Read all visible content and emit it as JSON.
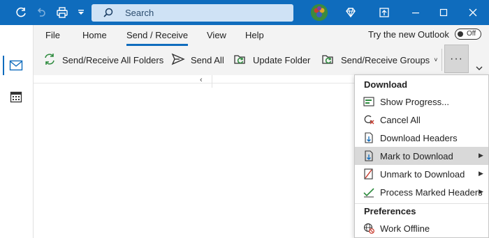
{
  "title_bar": {
    "search_placeholder": "Search",
    "icons": [
      "refresh-icon",
      "undo-icon",
      "print-icon",
      "customize-toolbar-icon",
      "search-icon",
      "avatar",
      "premium-diamond-icon",
      "popout-icon",
      "minimize-icon",
      "restore-icon",
      "close-icon"
    ]
  },
  "left_rail": {
    "items": [
      "mail-icon",
      "calendar-icon"
    ]
  },
  "ribbon": {
    "tabs": [
      "File",
      "Home",
      "Send / Receive",
      "View",
      "Help"
    ],
    "active_tab": "Send / Receive",
    "try_new": "Try the new Outlook",
    "toggle_label": "Off",
    "commands": [
      "Send/Receive All Folders",
      "Send All",
      "Update Folder",
      "Send/Receive Groups"
    ],
    "more_label": "···"
  },
  "menu": {
    "download_header": "Download",
    "download_items": [
      {
        "label": "Show Progress...",
        "icon": "progress-icon",
        "submenu": false
      },
      {
        "label": "Cancel All",
        "icon": "cancel-all-icon",
        "submenu": false
      },
      {
        "label": "Download Headers",
        "icon": "download-headers-icon",
        "submenu": false
      },
      {
        "label": "Mark to Download",
        "icon": "mark-download-icon",
        "submenu": true,
        "highlighted": true
      },
      {
        "label": "Unmark to Download",
        "icon": "unmark-download-icon",
        "submenu": true
      },
      {
        "label": "Process Marked Headers",
        "icon": "process-headers-icon",
        "submenu": true
      }
    ],
    "preferences_header": "Preferences",
    "preferences_items": [
      {
        "label": "Work Offline",
        "icon": "work-offline-icon",
        "submenu": false
      }
    ]
  },
  "colors": {
    "titlebar": "#0f6cbd",
    "ribbon_bg": "#f3f3f3",
    "accent": "#0f6cbd",
    "highlight": "#d9d9d9"
  }
}
